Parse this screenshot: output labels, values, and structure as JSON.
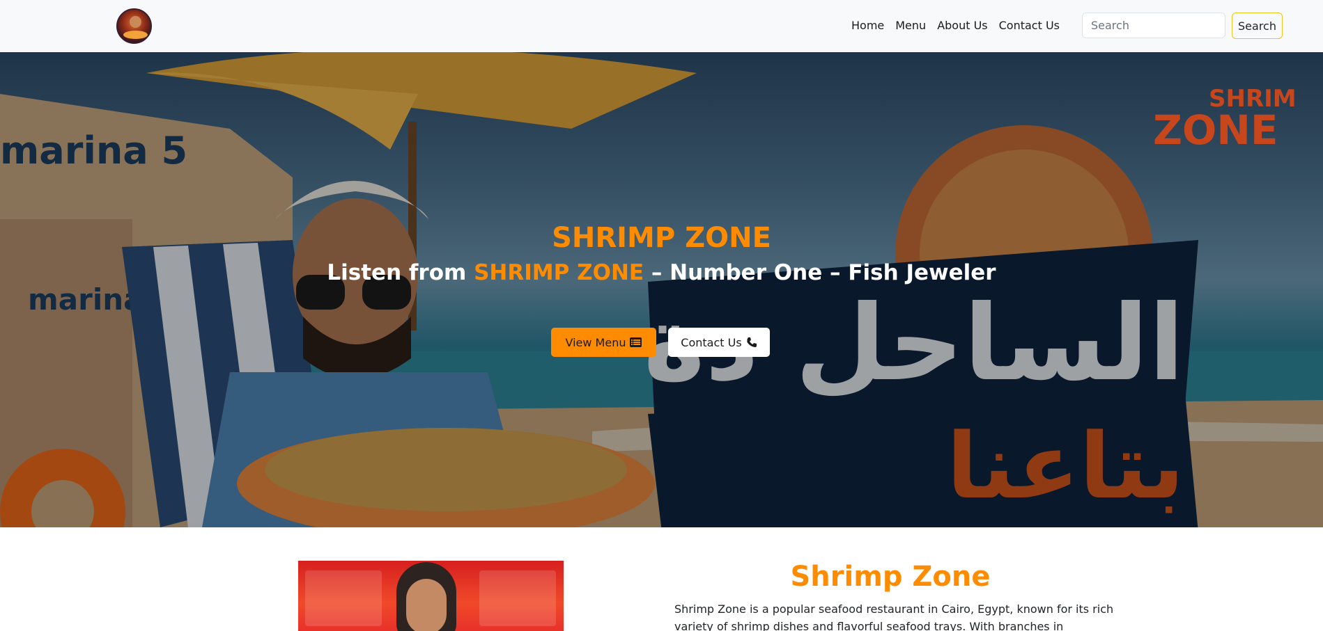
{
  "nav": {
    "links": [
      "Home",
      "Menu",
      "About Us",
      "Contact Us"
    ],
    "search_placeholder": "Search",
    "search_button": "Search"
  },
  "hero": {
    "title": "SHRIMP ZONE",
    "subtitle_prefix": "Listen from ",
    "subtitle_highlight": "SHRIMP ZONE",
    "subtitle_suffix": " – Number One – Fish Jeweler",
    "view_menu_label": "View Menu",
    "contact_label": "Contact Us",
    "brand_mark_line1": "SHRIMP",
    "brand_mark_line2": "ZONE",
    "sign_text": "marina 5",
    "sign_number": "5",
    "arabic_line1": "الساحل دة",
    "arabic_line2": "بتاعنا"
  },
  "about": {
    "title": "Shrimp Zone",
    "text": "Shrimp Zone is a popular seafood restaurant in Cairo, Egypt, known for its rich variety of shrimp dishes and flavorful seafood trays. With branches in Sheraton and Heliopolis, the"
  },
  "colors": {
    "accent": "#ff8c00",
    "navbar_bg": "#f8f9fa",
    "search_border": "#f0c419"
  },
  "icons": {
    "view_menu_icon": "list-icon",
    "contact_icon": "phone-icon"
  }
}
